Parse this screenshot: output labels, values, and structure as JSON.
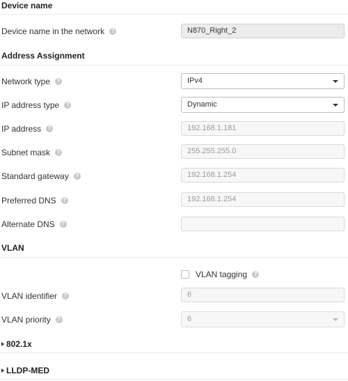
{
  "device_name": {
    "title": "Device name",
    "network_name_label": "Device name in the network",
    "network_name_value": "N870_Right_2"
  },
  "address_assignment": {
    "title": "Address Assignment",
    "network_type_label": "Network type",
    "network_type_value": "IPv4",
    "ip_type_label": "IP address type",
    "ip_type_value": "Dynamic",
    "ip_address_label": "IP address",
    "ip_address_value": "192.168.1.181",
    "subnet_label": "Subnet mask",
    "subnet_value": "255.255.255.0",
    "gateway_label": "Standard gateway",
    "gateway_value": "192.168.1.254",
    "preferred_dns_label": "Preferred DNS",
    "preferred_dns_value": "192.168.1.254",
    "alternate_dns_label": "Alternate DNS",
    "alternate_dns_value": ""
  },
  "vlan": {
    "title": "VLAN",
    "tagging_label": "VLAN tagging",
    "tagging_checked": false,
    "identifier_label": "VLAN identifier",
    "identifier_value": "6",
    "priority_label": "VLAN priority",
    "priority_value": "6"
  },
  "collapsed_sections": {
    "dot1x": "802.1x",
    "lldp": "LLDP-MED"
  },
  "help_glyph": "?",
  "icons": {
    "help": "help-circle-icon",
    "dropdown": "chevron-down-icon",
    "expand": "triangle-right-icon"
  },
  "colors": {
    "section_divider": "#ececec",
    "field_border": "#d8d8d8",
    "readonly_bg": "#f7f7f7",
    "help_icon": "#c8c8c8"
  }
}
